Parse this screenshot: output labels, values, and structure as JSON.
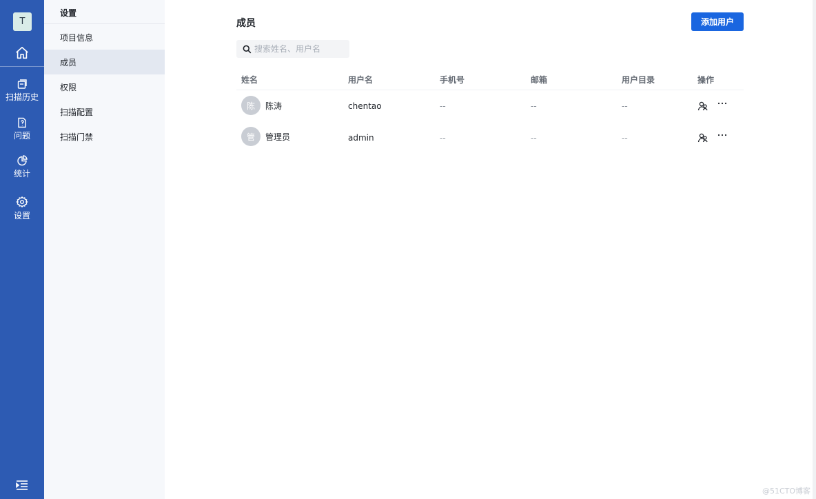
{
  "rail": {
    "avatar_letter": "T",
    "items": [
      {
        "label": "扫描历史",
        "icon": "history-icon"
      },
      {
        "label": "问题",
        "icon": "issue-file-icon"
      },
      {
        "label": "统计",
        "icon": "pie-chart-icon"
      },
      {
        "label": "设置",
        "icon": "gear-icon"
      }
    ]
  },
  "sidebar": {
    "title": "设置",
    "items": [
      {
        "label": "项目信息"
      },
      {
        "label": "成员",
        "active": true
      },
      {
        "label": "权限"
      },
      {
        "label": "扫描配置"
      },
      {
        "label": "扫描门禁"
      }
    ]
  },
  "main": {
    "title": "成员",
    "add_button": "添加用户",
    "search_placeholder": "搜索姓名、用户名",
    "columns": [
      "姓名",
      "用户名",
      "手机号",
      "邮箱",
      "用户目录",
      "操作"
    ],
    "rows": [
      {
        "avatar": "陈",
        "name": "陈涛",
        "username": "chentao",
        "phone": "--",
        "email": "--",
        "directory": "--"
      },
      {
        "avatar": "管",
        "name": "管理员",
        "username": "admin",
        "phone": "--",
        "email": "--",
        "directory": "--"
      }
    ]
  },
  "colors": {
    "rail": "#2d5bb3",
    "primary_button": "#1a66e0",
    "sidebar_bg": "#f6f8fb",
    "active_item": "#e3e8f1"
  },
  "watermark": "@51CTO博客"
}
